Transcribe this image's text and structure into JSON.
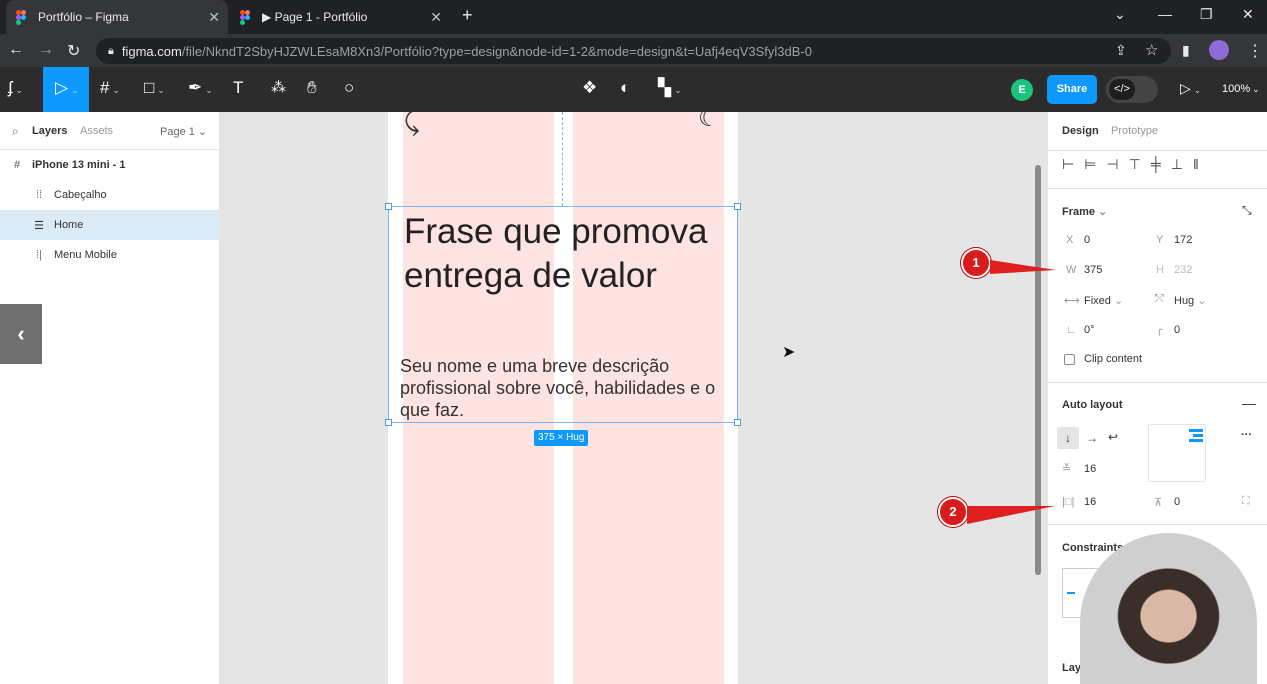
{
  "browser": {
    "tabs": [
      {
        "label": "Portfólio – Figma",
        "active": true
      },
      {
        "label": "▶ Page 1 - Portfólio",
        "active": false
      }
    ],
    "url_host": "figma.com",
    "url_path": "/file/NkndT2SbyHJZWLEsaM8Xn3/Portfólio?type=design&node-id=1-2&mode=design&t=Uafj4eqV3Sfyl3dB-0"
  },
  "toolbar": {
    "avatar_letter": "E",
    "share_label": "Share",
    "devmode_label": "</>",
    "zoom": "100%"
  },
  "left_panel": {
    "tabs": {
      "layers": "Layers",
      "assets": "Assets",
      "page": "Page 1"
    },
    "layers": [
      {
        "label": "iPhone 13 mini - 1",
        "icon": "#"
      },
      {
        "label": "Cabeçalho",
        "icon": "⁞⁞"
      },
      {
        "label": "Home",
        "icon": "☰"
      },
      {
        "label": "Menu Mobile",
        "icon": "⁞|"
      }
    ]
  },
  "canvas": {
    "headline": "Frase que promova entrega de valor",
    "description": "Seu nome e uma breve descrição profissional sobre você, habilidades e o que faz.",
    "size_badge": "375 × Hug"
  },
  "right_panel": {
    "tabs": {
      "design": "Design",
      "prototype": "Prototype"
    },
    "frame_label": "Frame",
    "x_label": "X",
    "x_value": "0",
    "y_label": "Y",
    "y_value": "172",
    "w_label": "W",
    "w_value": "375",
    "h_label": "H",
    "h_value": "232",
    "width_mode": "Fixed",
    "height_mode": "Hug",
    "rotation": "0°",
    "radius": "0",
    "clip_content": "Clip content",
    "auto_layout_label": "Auto layout",
    "gap": "16",
    "padding_h": "16",
    "padding_v": "0",
    "constraints_label": "Constraints",
    "layout_label": "Layout"
  },
  "callouts": [
    "1",
    "2"
  ],
  "colors": {
    "accent": "#0d99ff",
    "callout": "#d81b1b",
    "column": "#fde3e1"
  }
}
